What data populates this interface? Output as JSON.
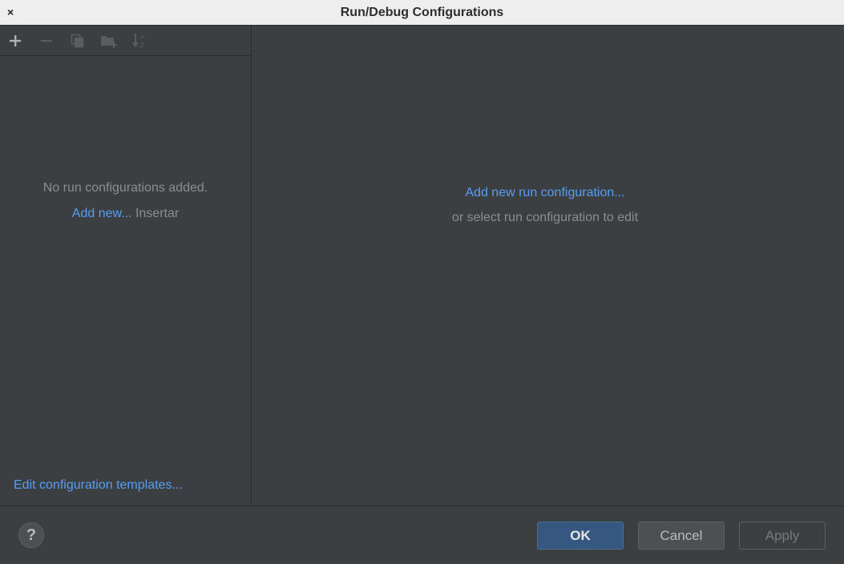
{
  "window": {
    "title": "Run/Debug Configurations",
    "close_glyph": "×"
  },
  "toolbar": {
    "icons": [
      "add-icon",
      "remove-icon",
      "copy-icon",
      "new-folder-icon",
      "sort-alphabetically-icon"
    ]
  },
  "left_panel": {
    "empty_message": "No run configurations added.",
    "add_new_link": "Add new...",
    "add_new_shortcut": "Insertar",
    "edit_templates_link": "Edit configuration templates..."
  },
  "right_panel": {
    "add_link": "Add new run configuration...",
    "hint": "or select run configuration to edit"
  },
  "footer": {
    "help_label": "?",
    "ok_label": "OK",
    "cancel_label": "Cancel",
    "apply_label": "Apply"
  },
  "colors": {
    "background": "#3c3f41",
    "link": "#589df6",
    "muted_text": "#8b8e90",
    "primary_button": "#365880",
    "titlebar": "#eeeeee"
  }
}
